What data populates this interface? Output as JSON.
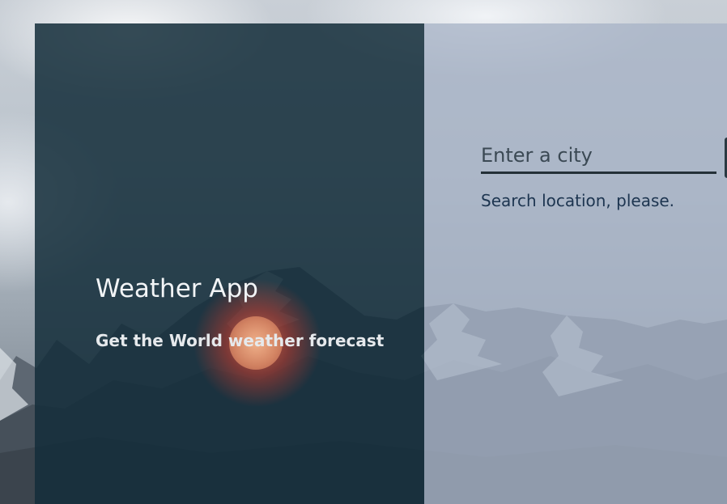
{
  "app": {
    "title": "Weather App",
    "subtitle": "Get the World weather forecast"
  },
  "search": {
    "placeholder": "Enter a city",
    "value": "",
    "hint": "Search location, please."
  },
  "colors": {
    "left_panel": "#142d3a",
    "right_panel": "#a8b4c6",
    "title_text": "#f2f4f6",
    "hint_text": "#1d3550",
    "sun_accent": "#e8503a"
  },
  "icons": {
    "background": "mountain-landscape-image",
    "decoration": "sun-glow-icon"
  }
}
